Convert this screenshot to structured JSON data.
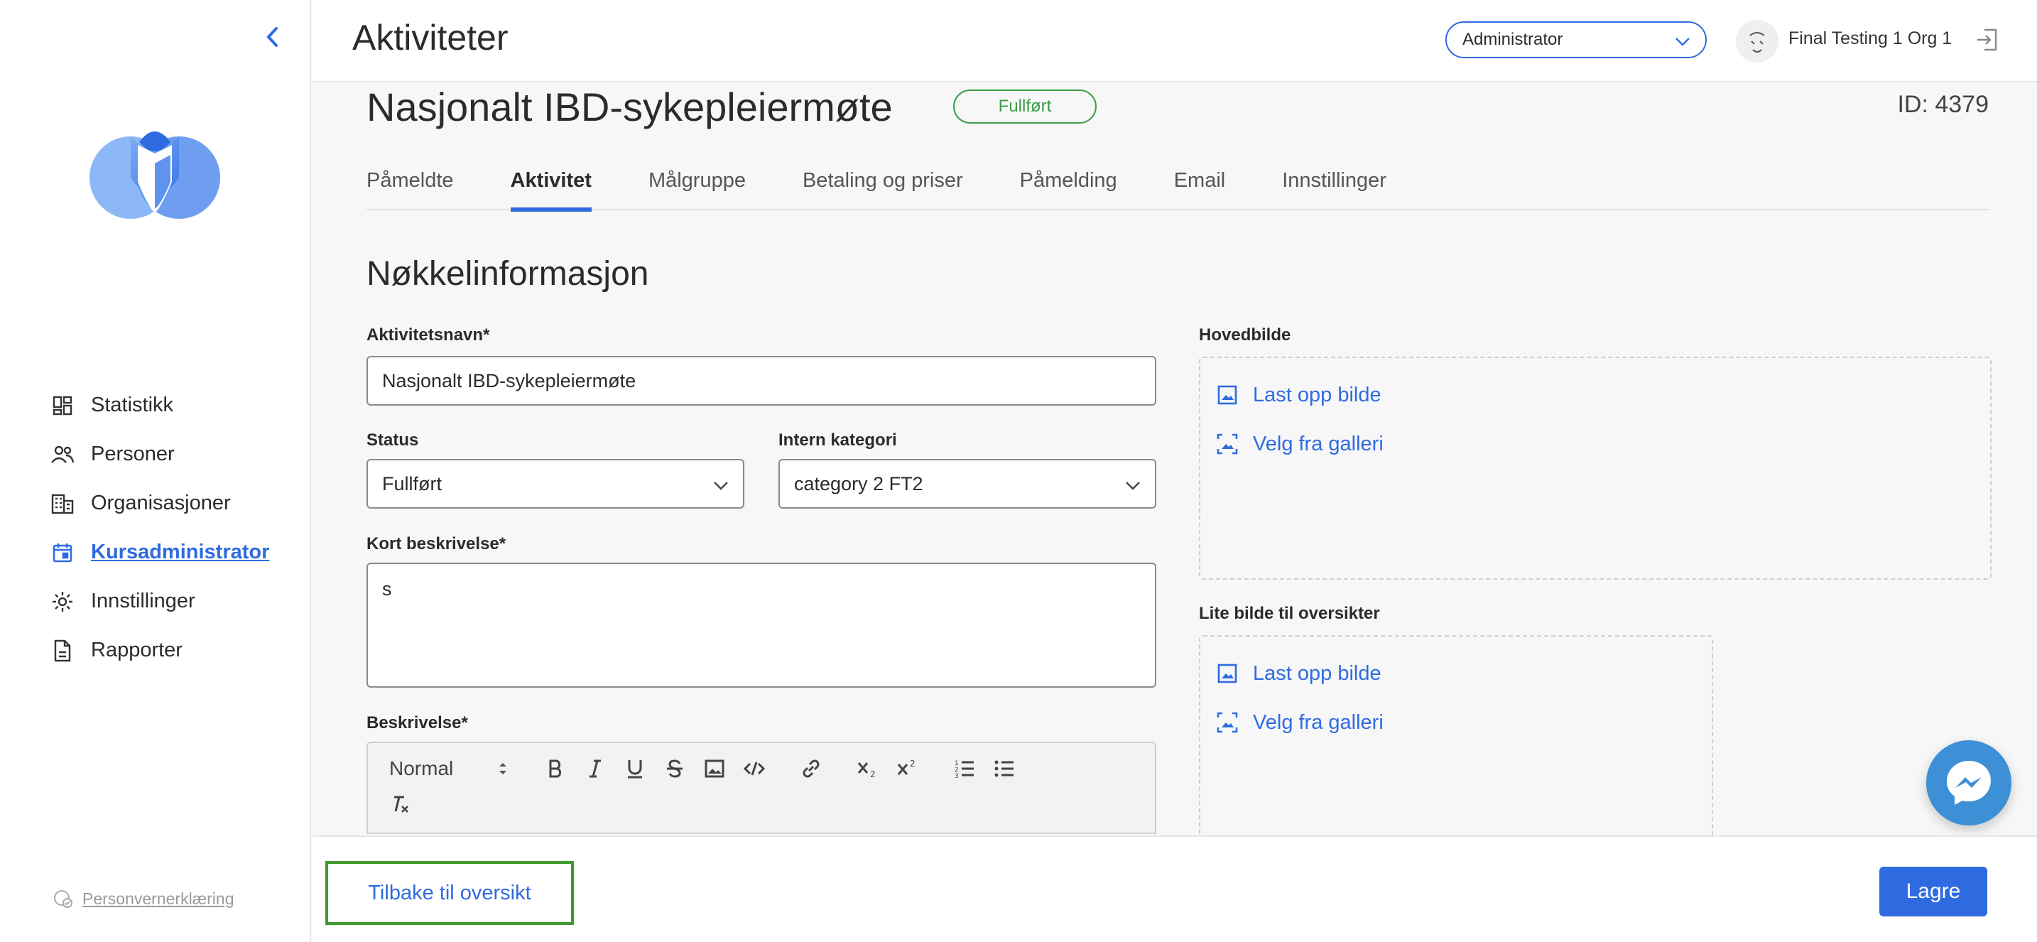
{
  "header": {
    "title": "Aktiviteter",
    "role": "Administrator",
    "org_name": "Final Testing 1 Org 1"
  },
  "sidebar": {
    "items": [
      {
        "label": "Statistikk",
        "icon": "dashboard-icon"
      },
      {
        "label": "Personer",
        "icon": "people-icon"
      },
      {
        "label": "Organisasjoner",
        "icon": "building-icon"
      },
      {
        "label": "Kursadministrator",
        "icon": "calendar-icon",
        "active": true
      },
      {
        "label": "Innstillinger",
        "icon": "gear-icon"
      },
      {
        "label": "Rapporter",
        "icon": "report-icon"
      }
    ],
    "privacy": "Personvernerklæring"
  },
  "activity": {
    "title": "Nasjonalt IBD-sykepleiermøte",
    "status_badge": "Fullført",
    "id_label": "ID: 4379"
  },
  "tabs": [
    "Påmeldte",
    "Aktivitet",
    "Målgruppe",
    "Betaling og priser",
    "Påmelding",
    "Email",
    "Innstillinger"
  ],
  "active_tab": "Aktivitet",
  "form": {
    "section_title": "Nøkkelinformasjon",
    "name_label": "Aktivitetsnavn*",
    "name_value": "Nasjonalt IBD-sykepleiermøte",
    "status_label": "Status",
    "status_value": "Fullført",
    "category_label": "Intern kategori",
    "category_value": "category 2 FT2",
    "short_desc_label": "Kort beskrivelse*",
    "short_desc_value": "s",
    "desc_label": "Beskrivelse*",
    "editor_format": "Normal"
  },
  "images": {
    "main_label": "Hovedbilde",
    "small_label": "Lite bilde til oversikter",
    "upload": "Last opp bilde",
    "gallery": "Velg fra galleri"
  },
  "footer": {
    "back": "Tilbake til oversikt",
    "save": "Lagre"
  },
  "colors": {
    "accent": "#2f6be0",
    "success": "#3a9d4a"
  }
}
